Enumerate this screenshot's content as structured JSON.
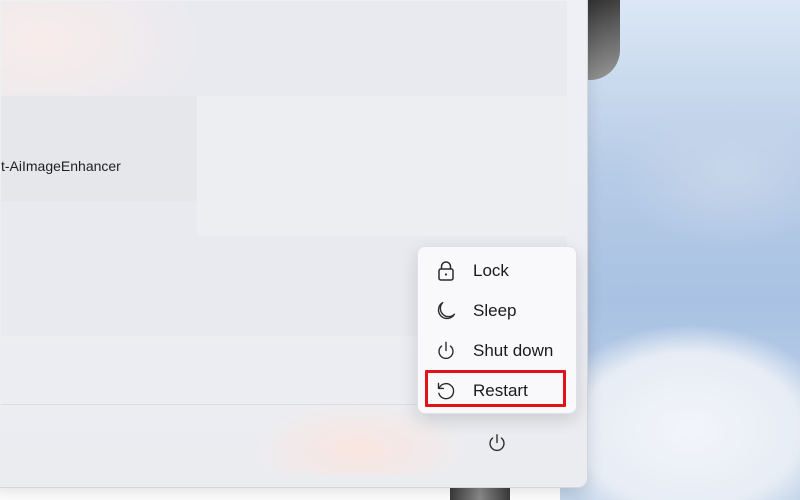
{
  "start_menu": {
    "app_label": "t-AiImageEnhancer"
  },
  "power_menu": {
    "items": [
      {
        "label": "Lock",
        "icon": "lock-icon"
      },
      {
        "label": "Sleep",
        "icon": "moon-icon"
      },
      {
        "label": "Shut down",
        "icon": "power-icon"
      },
      {
        "label": "Restart",
        "icon": "restart-icon"
      }
    ],
    "highlighted_item": "Restart",
    "highlight_color": "#e0131a"
  },
  "footer": {
    "power_button_icon": "power-icon"
  }
}
